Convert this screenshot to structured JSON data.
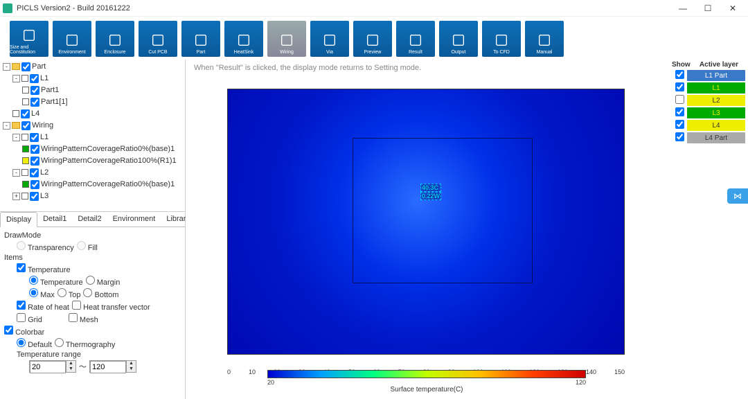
{
  "title": "PICLS Version2 - Build 20161222",
  "win": {
    "min": "—",
    "max": "☐",
    "close": "✕"
  },
  "toolbar": [
    {
      "label": "Size and Constitution",
      "icon": "rect"
    },
    {
      "label": "Environment",
      "icon": "wave"
    },
    {
      "label": "Enclosure",
      "icon": "box"
    },
    {
      "label": "Cut PCB",
      "icon": "scissor"
    },
    {
      "label": "Part",
      "icon": "chip"
    },
    {
      "label": "HeatSink",
      "icon": "fins"
    },
    {
      "label": "Wiring",
      "icon": "wire",
      "disabled": true
    },
    {
      "label": "Via",
      "icon": "via"
    },
    {
      "label": "Preview",
      "icon": "search"
    },
    {
      "label": "Result",
      "icon": "monitor"
    },
    {
      "label": "Output",
      "icon": "out"
    },
    {
      "label": "To CFD",
      "icon": "cube"
    },
    {
      "label": "Manual",
      "icon": "book"
    }
  ],
  "hint": "When \"Result\" is clicked, the display mode returns to Setting mode.",
  "tree": {
    "part": "Part",
    "l1": "L1",
    "p1": "Part1",
    "p1b": "Part1[1]",
    "l4": "L4",
    "wiring": "Wiring",
    "wl1": "L1",
    "w1": "WiringPatternCoverageRatio0%(base)1",
    "w2": "WiringPatternCoverageRatio100%(R1)1",
    "wl2": "L2",
    "w3": "WiringPatternCoverageRatio0%(base)1",
    "wl3": "L3"
  },
  "tabs": [
    "Display",
    "Detail1",
    "Detail2",
    "Environment",
    "Library"
  ],
  "props": {
    "drawmode": "DrawMode",
    "transparency": "Transparency",
    "fill": "Fill",
    "items": "Items",
    "temperature": "Temperature",
    "temperature2": "Temperature",
    "margin": "Margin",
    "max": "Max",
    "top": "Top",
    "bottom": "Bottom",
    "roh": "Rate of heat",
    "htv": "Heat transfer vector",
    "grid": "Grid",
    "mesh": "Mesh",
    "colorbar": "Colorbar",
    "default": "Default",
    "thermo": "Thermography",
    "trange": "Temperature range",
    "tmin": "20",
    "tmax": "120",
    "tilde": "～"
  },
  "viz": {
    "mark_line1": "40.3C",
    "mark_line2": "0.22W"
  },
  "axis_ticks": [
    "0",
    "10",
    "20",
    "30",
    "40",
    "50",
    "60",
    "70",
    "80",
    "90",
    "100",
    "110",
    "120",
    "130",
    "140",
    "150"
  ],
  "cbar": {
    "min": "20",
    "max": "120",
    "title": "Surface temperature(C)"
  },
  "layers": {
    "hdr_show": "Show",
    "hdr_active": "Active layer",
    "rows": [
      {
        "label": "L1 Part",
        "cls": "l-active",
        "checked": true
      },
      {
        "label": "L1",
        "cls": "l-g",
        "checked": true
      },
      {
        "label": "L2",
        "cls": "l-y",
        "checked": false
      },
      {
        "label": "L3",
        "cls": "l-g",
        "checked": true
      },
      {
        "label": "L4",
        "cls": "l-y",
        "checked": true
      },
      {
        "label": "L4 Part",
        "cls": "l-gray",
        "checked": true
      }
    ]
  },
  "chart_data": {
    "type": "heatmap",
    "title": "Surface temperature(C)",
    "xlabel": "",
    "ylabel": "",
    "colorbar_range": [
      20,
      120
    ],
    "axis_range_x": [
      0,
      150
    ],
    "annotations": [
      {
        "text": "40.3C",
        "approx_position": "center"
      },
      {
        "text": "0.22W",
        "approx_position": "center"
      }
    ],
    "note": "Thermal simulation result; radial gradient from ~40C at center part down toward ambient across PCB surface. Inner rectangle denotes component outline."
  }
}
